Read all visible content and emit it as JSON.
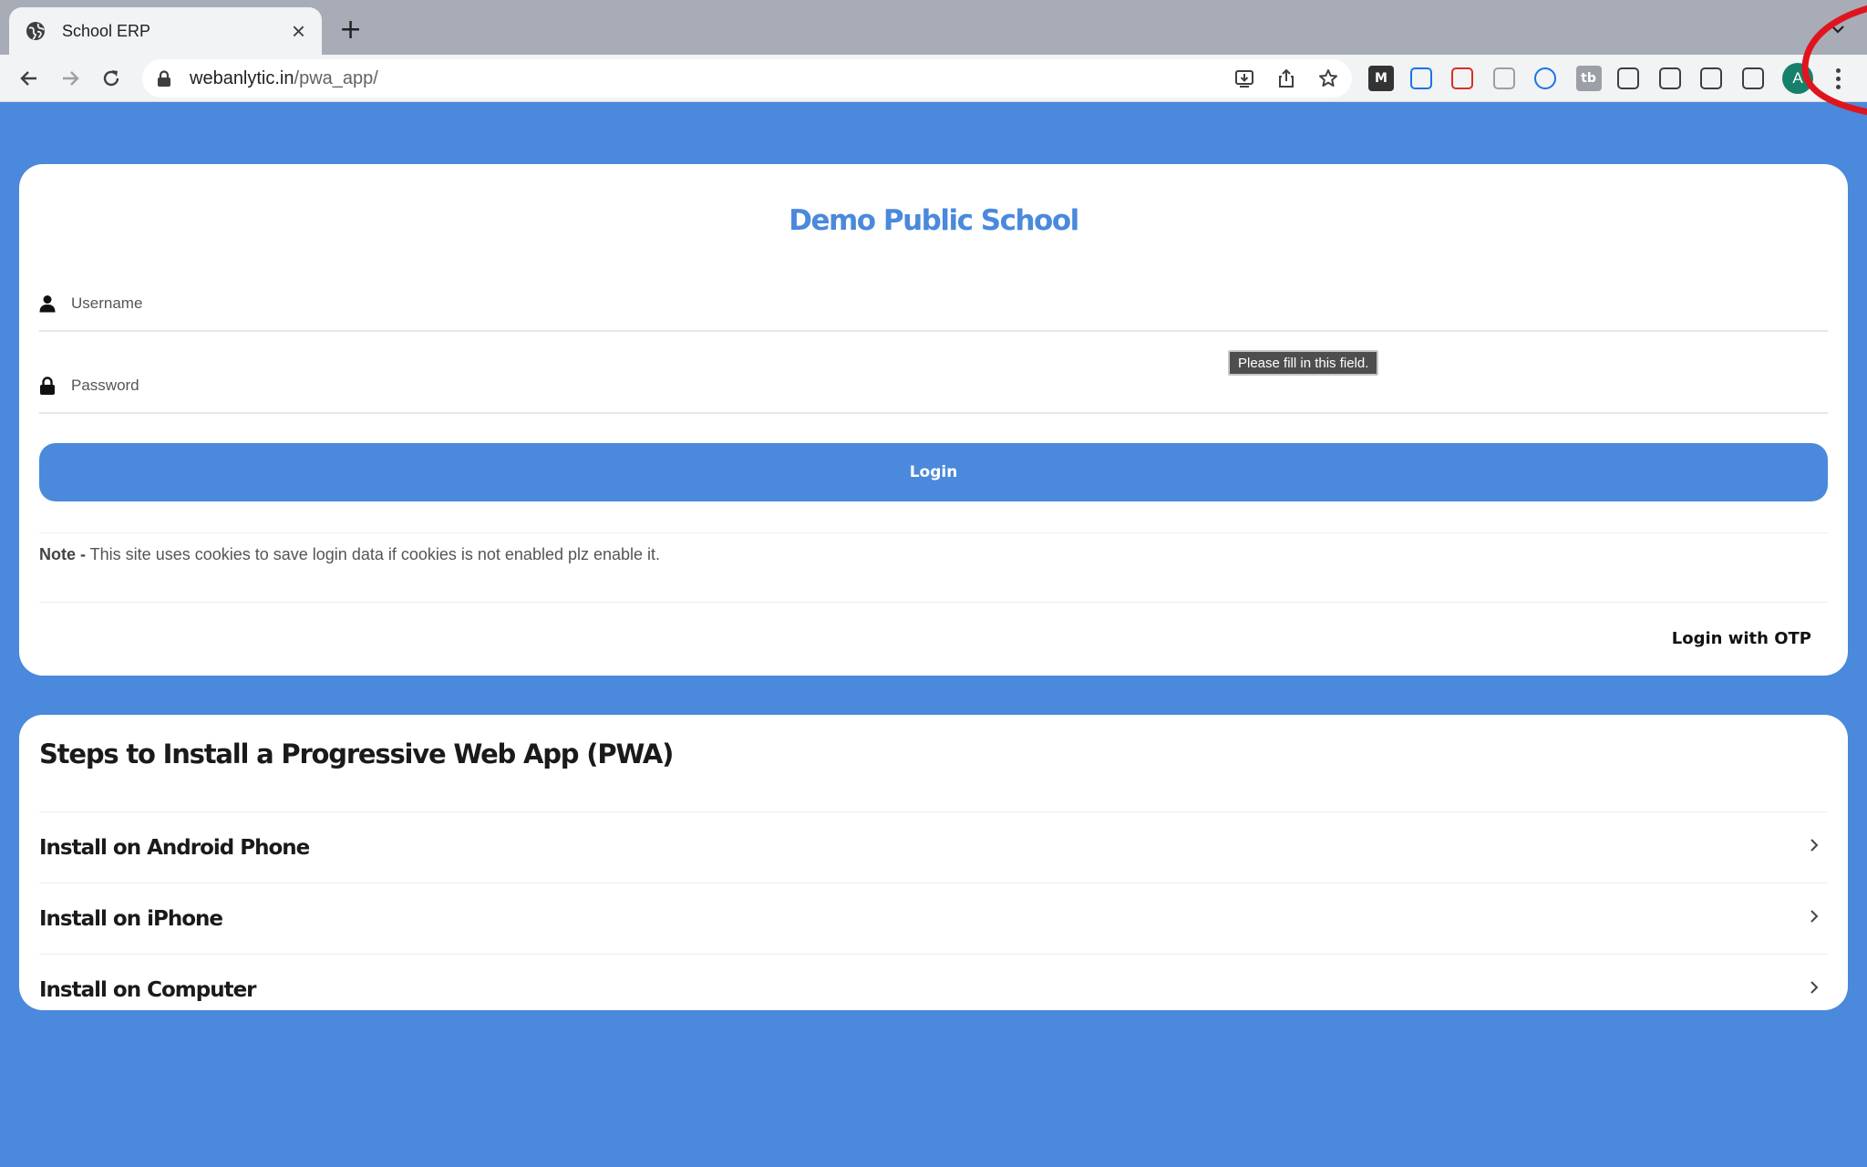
{
  "browser": {
    "tab_title": "School ERP",
    "new_tab_symbol": "+",
    "close_symbol": "×",
    "url_host": "webanlytic.in",
    "url_path": "/pwa_app/",
    "profile_initial": "A",
    "extensions": [
      {
        "icon": "m-extension-icon",
        "label": "M",
        "color": "#333333"
      },
      {
        "icon": "id-card-extension-icon",
        "label": "",
        "color": "#1a73e8"
      },
      {
        "icon": "shop-extension-icon",
        "label": "",
        "color": "#d93025"
      },
      {
        "icon": "eraser-extension-icon",
        "label": "",
        "color": "#9aa0a6"
      },
      {
        "icon": "play-extension-icon",
        "label": "",
        "color": "#1a73e8"
      },
      {
        "icon": "tb-extension-icon",
        "label": "tb",
        "color": "#9aa0a6"
      },
      {
        "icon": "puzzle-extension-icon",
        "label": "",
        "color": "#3c4043"
      },
      {
        "icon": "bolt-extension-icon",
        "label": "",
        "color": "#3c4043"
      },
      {
        "icon": "media-queue-icon",
        "label": "",
        "color": "#3c4043"
      },
      {
        "icon": "sidepanel-icon",
        "label": "",
        "color": "#3c4043"
      }
    ]
  },
  "login": {
    "school_name": "Demo Public School",
    "username_placeholder": "Username",
    "password_placeholder": "Password",
    "validation_tooltip": "Please fill in this field.",
    "login_label": "Login",
    "note_label": "Note -",
    "note_text": " This site uses cookies to save login data if cookies is not enabled plz enable it.",
    "otp_label": "Login with OTP"
  },
  "steps": {
    "title": "Steps to Install a Progressive Web App (PWA)",
    "items": [
      {
        "label": "Install on Android Phone"
      },
      {
        "label": "Install on iPhone"
      },
      {
        "label": "Install on Computer"
      }
    ]
  },
  "colors": {
    "page_background": "#4a89dc",
    "accent": "#4a89dc",
    "avatar": "#17806a",
    "annotation": "#e0141e"
  }
}
